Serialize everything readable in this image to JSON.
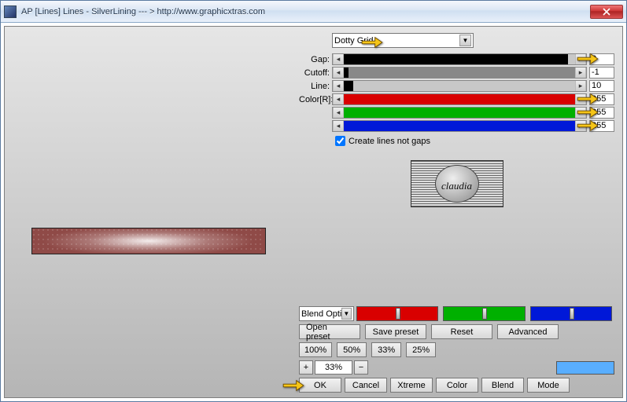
{
  "window": {
    "title": "AP [Lines]  Lines - SilverLining    --- > http://www.graphicxtras.com"
  },
  "preset_dropdown": {
    "selected": "Dotty Grid"
  },
  "sliders": {
    "gap": {
      "label": "Gap:",
      "value": "8",
      "fill_pct": 97,
      "fill_color": "#000000",
      "track_color": "#c8c8c8"
    },
    "cutoff": {
      "label": "Cutoff:",
      "value": "-1",
      "fill_pct": 2,
      "fill_color": "#000000",
      "track_color": "#888888"
    },
    "line": {
      "label": "Line:",
      "value": "10",
      "fill_pct": 4,
      "fill_color": "#000000",
      "track_color": "#c8c8c8"
    },
    "r": {
      "label": "Color[R]:",
      "value": "255",
      "fill_pct": 100,
      "fill_color": "#d90000",
      "track_color": "#d90000"
    },
    "g": {
      "label": "",
      "value": "255",
      "fill_pct": 100,
      "fill_color": "#00b000",
      "track_color": "#00b000"
    },
    "b": {
      "label": "",
      "value": "255",
      "fill_pct": 100,
      "fill_color": "#0018d8",
      "track_color": "#0018d8"
    }
  },
  "create_lines": {
    "label": "Create lines not gaps",
    "checked": true
  },
  "logo_text": "claudia",
  "blend_option": {
    "selected": "Blend Optio"
  },
  "buttons": {
    "open_preset": "Open preset",
    "save_preset": "Save preset",
    "reset": "Reset",
    "advanced": "Advanced",
    "p100": "100%",
    "p50": "50%",
    "p33": "33%",
    "p25": "25%",
    "ok": "OK",
    "cancel": "Cancel",
    "xtreme": "Xtreme",
    "color": "Color",
    "blend": "Blend",
    "mode": "Mode"
  },
  "zoom": {
    "minus": "−",
    "plus": "+",
    "value": "33%"
  },
  "swatch_color": "#59aeff"
}
